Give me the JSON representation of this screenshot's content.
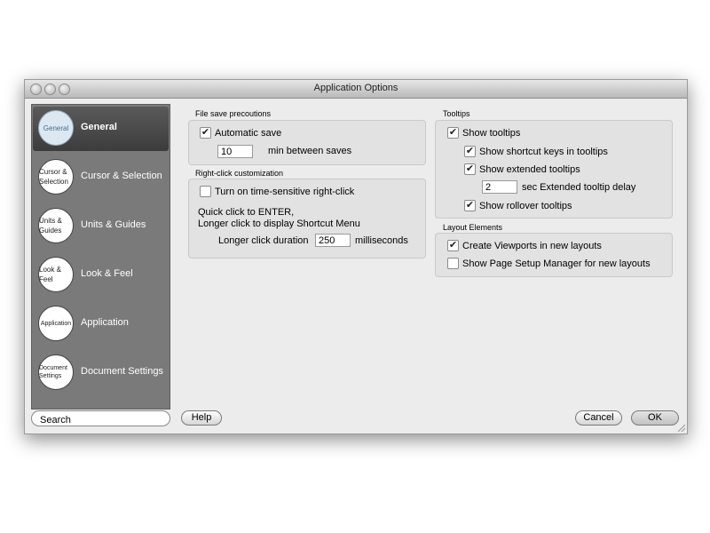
{
  "window": {
    "title": "Application Options"
  },
  "sidebar": {
    "items": [
      {
        "icon_text": "General",
        "label": "General",
        "selected": true
      },
      {
        "icon_text": "Cursor & Selection",
        "label": "Cursor & Selection",
        "selected": false
      },
      {
        "icon_text": "Units & Guides",
        "label": "Units & Guides",
        "selected": false
      },
      {
        "icon_text": "Look & Feel",
        "label": "Look & Feel",
        "selected": false
      },
      {
        "icon_text": "Application",
        "label": "Application",
        "selected": false
      },
      {
        "icon_text": "Document Settings",
        "label": "Document Settings",
        "selected": false
      }
    ],
    "search_placeholder": "Search"
  },
  "file_save": {
    "title": "File save precoutions",
    "automatic_save_label": "Automatic save",
    "automatic_save_checked": true,
    "interval_value": "10",
    "interval_suffix": "min between saves"
  },
  "right_click": {
    "title": "Right-click customization",
    "time_sensitive_label": "Turn on time-sensitive right-click",
    "time_sensitive_checked": false,
    "line1": "Quick click to ENTER,",
    "line2": "Longer click to display Shortcut Menu",
    "duration_label": "Longer click duration",
    "duration_value": "250",
    "duration_suffix": "milliseconds"
  },
  "tooltips": {
    "title": "Tooltips",
    "show_tooltips": "Show tooltips",
    "show_shortcut_keys": "Show shortcut keys in tooltips",
    "show_extended": "Show extended tooltips",
    "delay_value": "2",
    "delay_suffix": "sec Extended tooltip delay",
    "show_rollover": "Show rollover tooltips"
  },
  "layout_elements": {
    "title": "Layout Elements",
    "create_viewports": "Create Viewports in new layouts",
    "create_viewports_checked": true,
    "page_setup": "Show Page Setup Manager for new layouts",
    "page_setup_checked": false
  },
  "buttons": {
    "help": "Help",
    "cancel": "Cancel",
    "ok": "OK"
  },
  "icons": {
    "check": "✔"
  }
}
